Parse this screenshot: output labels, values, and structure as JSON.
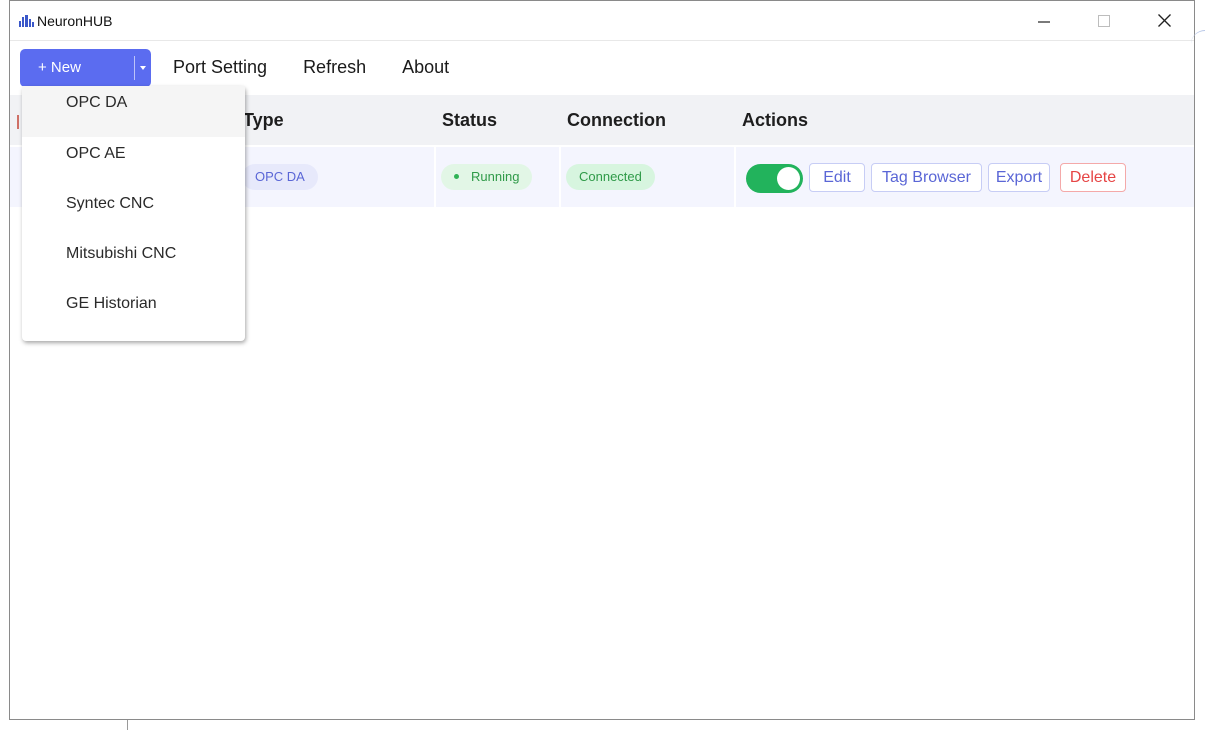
{
  "titlebar": {
    "app_title": "NeuronHUB",
    "logo_icon": "neuron-logo-icon",
    "minimize_icon": "minimize-icon",
    "maximize_icon": "maximize-icon",
    "close_icon": "close-icon"
  },
  "toolbar": {
    "new_label": "+ New",
    "new_caret_icon": "caret-down-icon",
    "port_setting": "Port Setting",
    "refresh": "Refresh",
    "about": "About"
  },
  "dropdown": {
    "items": [
      "OPC DA",
      "OPC AE",
      "Syntec CNC",
      "Mitsubishi CNC",
      "GE Historian"
    ]
  },
  "table": {
    "headers": {
      "type": "Type",
      "status": "Status",
      "connection": "Connection",
      "actions": "Actions"
    },
    "rows": [
      {
        "type": "OPC DA",
        "status": "Running",
        "connection": "Connected",
        "enabled": true,
        "actions": {
          "edit": "Edit",
          "tag_browser": "Tag Browser",
          "export": "Export",
          "delete": "Delete"
        }
      }
    ]
  },
  "colors": {
    "primary": "#5b6cf0",
    "success": "#22b35c",
    "danger": "#e64545"
  }
}
